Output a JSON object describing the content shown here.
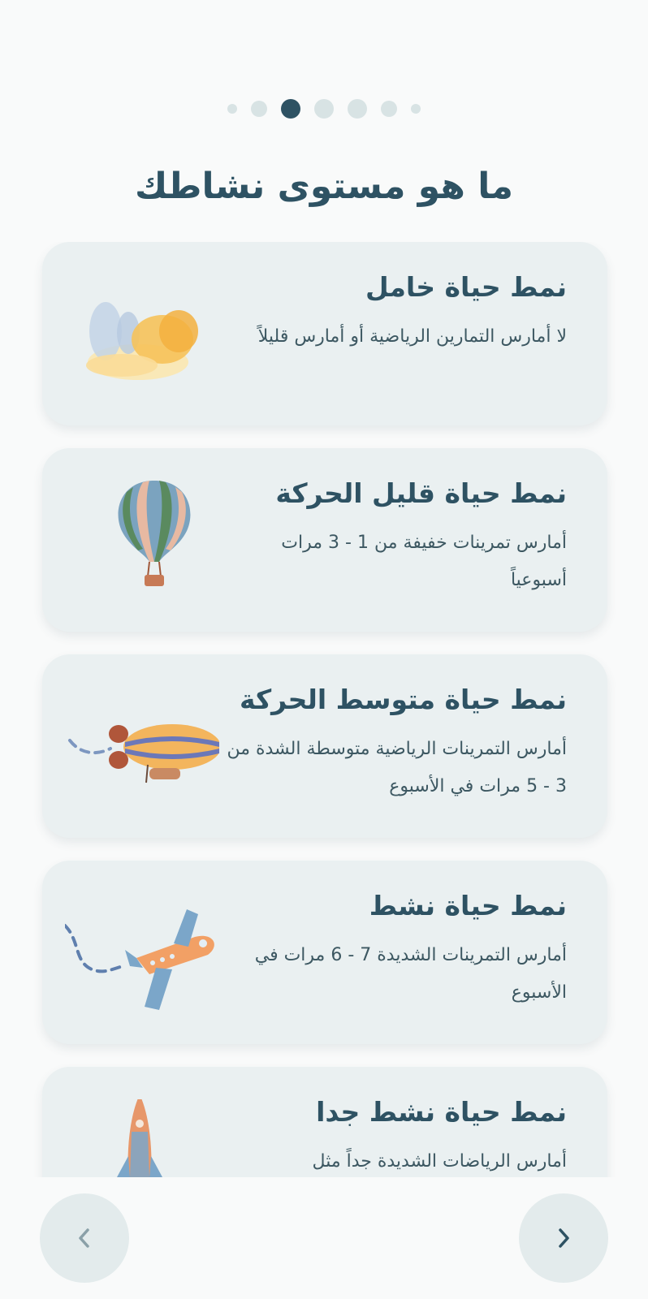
{
  "header": {
    "title": "ما هو مستوى نشاطك",
    "pager": {
      "count": 7,
      "active_index": 2
    }
  },
  "options": [
    {
      "title": "نمط حياة خامل",
      "description": "لا أمارس التمارين الرياضية أو أمارس قليلاً",
      "icon": "clouds-icon"
    },
    {
      "title": "نمط حياة قليل الحركة",
      "description": "أمارس تمرينات خفيفة من 1 - 3 مرات أسبوعياً",
      "icon": "hot-air-balloon-icon"
    },
    {
      "title": "نمط حياة متوسط الحركة",
      "description": "أمارس التمرينات الرياضية متوسطة الشدة من 3 - 5 مرات في الأسبوع",
      "icon": "airship-icon"
    },
    {
      "title": "نمط حياة نشط",
      "description": "أمارس التمرينات الشديدة 7 - 6 مرات في الأسبوع",
      "icon": "airplane-icon"
    },
    {
      "title": "نمط حياة نشط جدا",
      "description": "أمارس الرياضات الشديدة جداً مثل",
      "icon": "rocket-icon"
    }
  ],
  "navigation": {
    "prev_icon": "chevron-left-icon",
    "next_icon": "chevron-right-icon"
  },
  "colors": {
    "accent": "#2e5263",
    "card_bg": "#eaf0f1",
    "page_bg": "#f9fafa",
    "dot_inactive": "#d8e3e4"
  }
}
